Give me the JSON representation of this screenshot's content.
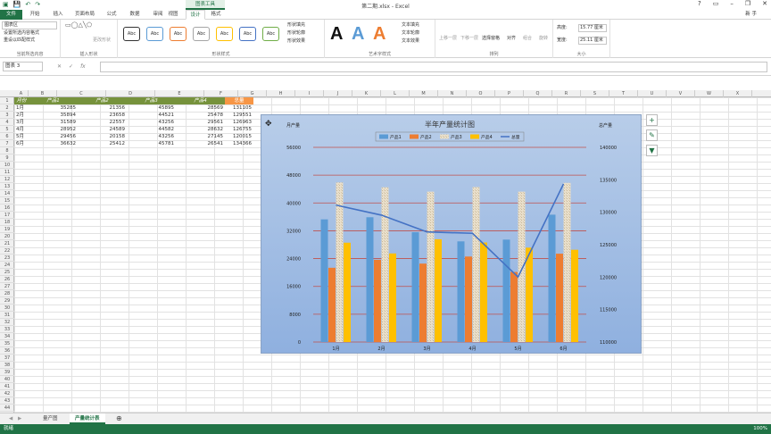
{
  "window": {
    "title": "第二期.xlsx - Excel",
    "context_tool": "图表工具",
    "user": "新 手"
  },
  "tabs": [
    "文件",
    "开始",
    "插入",
    "页面布局",
    "公式",
    "数据",
    "审阅",
    "视图",
    "设计",
    "格式"
  ],
  "ribbon": {
    "current_selection": {
      "dropdown": "图表区",
      "btn_format_selection": "设置所选内容格式",
      "btn_reset_style": "重设以匹配样式",
      "label": "当前所选内容"
    },
    "insert_shapes": {
      "label": "插入形状",
      "change_shape": "更改形状"
    },
    "shape_styles": {
      "label": "形状样式",
      "preset": "Abc",
      "fill": "形状填充",
      "outline": "形状轮廓",
      "effects": "形状效果"
    },
    "wordart": {
      "label": "艺术字样式",
      "letter": "A",
      "text_fill": "文本填充",
      "text_outline": "文本轮廓",
      "text_effects": "文本效果"
    },
    "arrange": {
      "label": "排列",
      "bring_forward": "上移一层",
      "send_backward": "下移一层",
      "selection_pane": "选择窗格",
      "align": "对齐",
      "group": "组合",
      "rotate": "旋转"
    },
    "size": {
      "label": "大小",
      "height_label": "高度:",
      "height_value": "15.77 厘米",
      "width_label": "宽度:",
      "width_value": "25.11 厘米"
    }
  },
  "formula_bar": {
    "name_box": "图表 3",
    "fx": "fx",
    "cancel": "✕",
    "enter": "✓",
    "content": ""
  },
  "columns": [
    "A",
    "B",
    "C",
    "D",
    "E",
    "F",
    "G",
    "H",
    "I",
    "J",
    "K",
    "L",
    "M",
    "N",
    "O",
    "P",
    "Q",
    "R",
    "S",
    "T",
    "U",
    "V",
    "W",
    "X"
  ],
  "rows": [
    "1",
    "2",
    "3",
    "4",
    "5",
    "6",
    "7",
    "8",
    "9",
    "10",
    "11",
    "12",
    "13",
    "14",
    "15",
    "16",
    "17",
    "18",
    "19",
    "20",
    "21",
    "22",
    "23",
    "24",
    "25",
    "26",
    "27",
    "28",
    "29",
    "30",
    "31",
    "32",
    "33",
    "34",
    "35",
    "36",
    "37",
    "38",
    "39",
    "40",
    "41",
    "42",
    "43",
    "44"
  ],
  "table": {
    "headers": [
      "月份",
      "产品1",
      "产品2",
      "产品3",
      "产品4",
      "总量"
    ],
    "rows": [
      [
        "1月",
        "35285",
        "21356",
        "45895",
        "28569",
        "131105"
      ],
      [
        "2月",
        "35894",
        "23658",
        "44521",
        "25478",
        "129551"
      ],
      [
        "3月",
        "31589",
        "22557",
        "43256",
        "29561",
        "126963"
      ],
      [
        "4月",
        "28952",
        "24589",
        "44582",
        "28632",
        "126755"
      ],
      [
        "5月",
        "29456",
        "20158",
        "43256",
        "27145",
        "120015"
      ],
      [
        "6月",
        "36632",
        "25412",
        "45781",
        "26541",
        "134366"
      ]
    ]
  },
  "chart_data": {
    "type": "bar",
    "title": "半年产量统计图",
    "ylabel": "月产量",
    "y2label": "总产量",
    "categories": [
      "1月",
      "2月",
      "3月",
      "4月",
      "5月",
      "6月"
    ],
    "series": [
      {
        "name": "产品1",
        "values": [
          35285,
          35894,
          31589,
          28952,
          29456,
          36632
        ],
        "color": "#5b9bd5"
      },
      {
        "name": "产品2",
        "values": [
          21356,
          23658,
          22557,
          24589,
          20158,
          25412
        ],
        "color": "#ed7d31"
      },
      {
        "name": "产品3",
        "values": [
          45895,
          44521,
          43256,
          44582,
          43256,
          45781
        ],
        "color": "#e8dcc8"
      },
      {
        "name": "产品4",
        "values": [
          28569,
          25478,
          29561,
          28632,
          27145,
          26541
        ],
        "color": "#ffc000"
      },
      {
        "name": "总量",
        "values": [
          131105,
          129551,
          126963,
          126755,
          120015,
          134366
        ],
        "color": "#4472c4",
        "axis": "secondary",
        "kind": "line"
      }
    ],
    "ylim": [
      0,
      56000
    ],
    "yticks": [
      "0",
      "8000",
      "16000",
      "24000",
      "32000",
      "40000",
      "48000",
      "56000"
    ],
    "y2lim": [
      110000,
      140000
    ],
    "y2ticks": [
      "110000",
      "115000",
      "120000",
      "125000",
      "130000",
      "135000",
      "140000"
    ],
    "legend": "top-center",
    "grid": true,
    "gridline_color": "#c0504d"
  },
  "sheet_tabs": [
    "量产图",
    "产量统计表"
  ],
  "active_sheet": "产量统计表",
  "status": {
    "left": "就绪",
    "zoom": "100%"
  }
}
